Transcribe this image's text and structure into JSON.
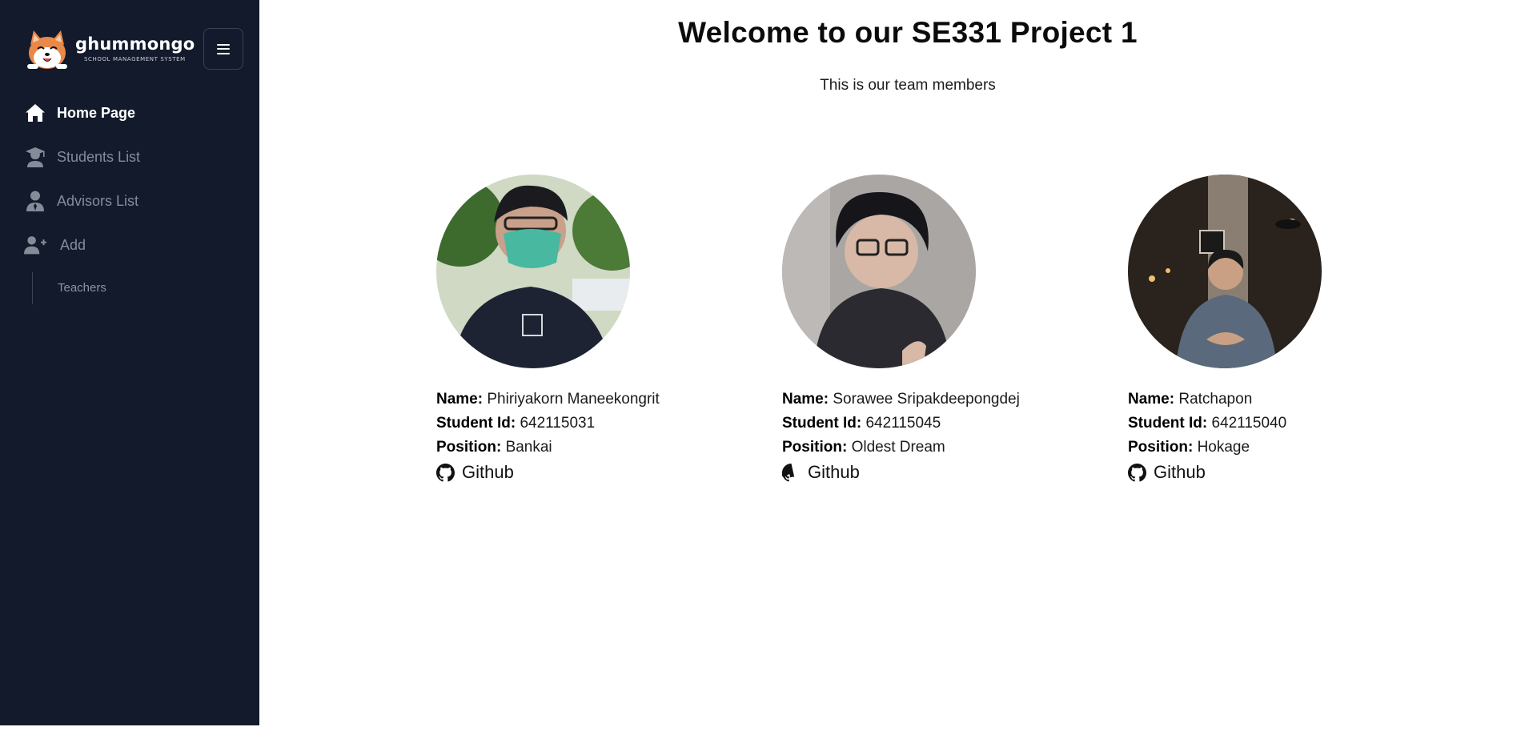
{
  "brand": {
    "name": "ghummongo",
    "subtitle": "SCHOOL MANAGEMENT SYSTEM"
  },
  "sidebar": {
    "menu_icon": "hamburger-icon",
    "items": [
      {
        "label": "Home Page",
        "icon": "home-icon",
        "active": true
      },
      {
        "label": "Students List",
        "icon": "graduate-icon",
        "active": false
      },
      {
        "label": "Advisors List",
        "icon": "user-tie-icon",
        "active": false
      },
      {
        "label": "Add",
        "icon": "user-plus-icon",
        "active": false
      }
    ],
    "subitems": [
      {
        "label": "Teachers"
      }
    ]
  },
  "main": {
    "title": "Welcome to our SE331 Project 1",
    "subtitle": "This is our team members"
  },
  "labels": {
    "name": "Name:",
    "student_id": "Student Id:",
    "position": "Position:",
    "github": "Github"
  },
  "members": [
    {
      "name": "Phiriyakorn Maneekongrit",
      "student_id": "642115031",
      "position": "Bankai"
    },
    {
      "name": "Sorawee Sripakdeepongdej",
      "student_id": "642115045",
      "position": "Oldest Dream"
    },
    {
      "name": "Ratchapon",
      "student_id": "642115040",
      "position": "Hokage"
    }
  ],
  "colors": {
    "sidebar_bg": "#131a2b",
    "active_text": "#ffffff",
    "inactive_text": "#858b99"
  }
}
